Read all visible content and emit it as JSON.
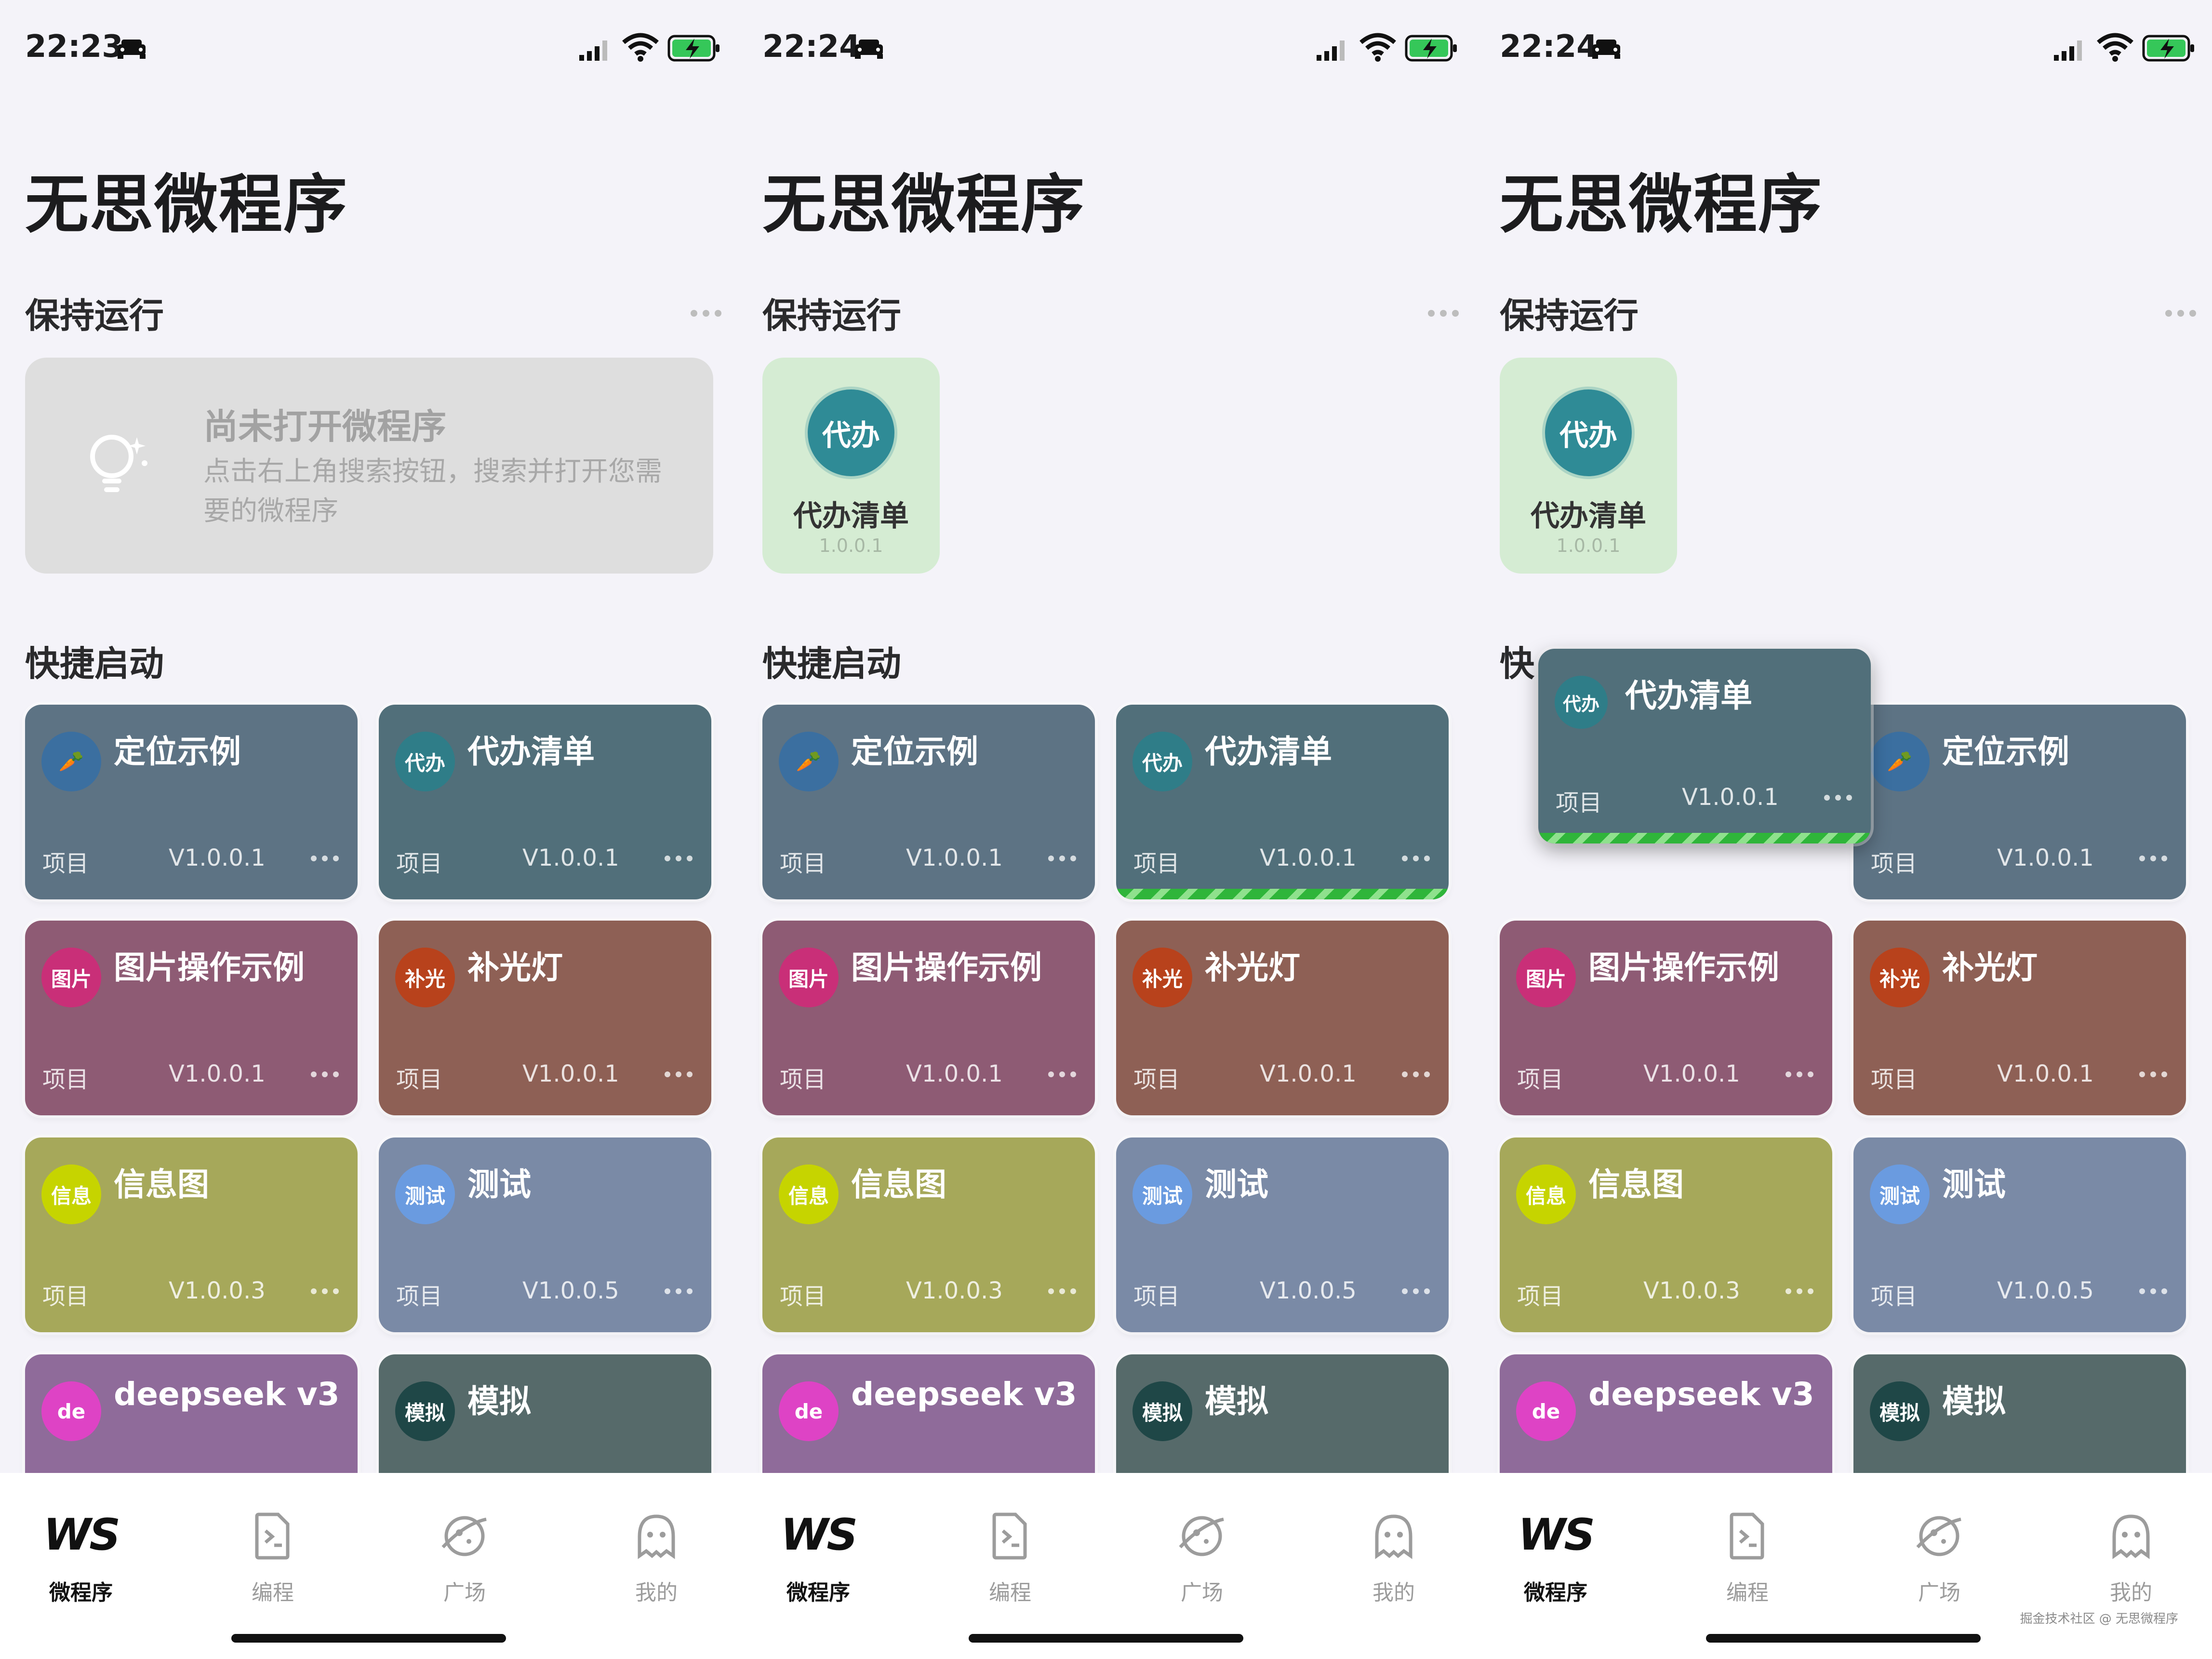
{
  "screens": [
    {
      "status": {
        "time": "22:23"
      },
      "title": "无思微程序",
      "keep_running": {
        "label": "保持运行",
        "empty_title": "尚未打开微程序",
        "empty_desc": "点击右上角搜索按钮，搜索并打开您需要的微程序"
      },
      "quick_launch": {
        "label": "快捷启动"
      }
    },
    {
      "status": {
        "time": "22:24"
      },
      "title": "无思微程序",
      "keep_running": {
        "label": "保持运行",
        "app": {
          "badge": "代办",
          "name": "代办清单",
          "version": "1.0.0.1"
        }
      },
      "quick_launch": {
        "label": "快捷启动"
      }
    },
    {
      "status": {
        "time": "22:24"
      },
      "title": "无思微程序",
      "keep_running": {
        "label": "保持运行",
        "app": {
          "badge": "代办",
          "name": "代办清单",
          "version": "1.0.0.1"
        }
      },
      "quick_launch": {
        "label": "快"
      }
    }
  ],
  "cards": {
    "loc": {
      "badge": "🥕",
      "name": "定位示例",
      "type": "项目",
      "version": "V1.0.0.1"
    },
    "todo": {
      "badge": "代办",
      "name": "代办清单",
      "type": "项目",
      "version": "V1.0.0.1"
    },
    "img": {
      "badge": "图片",
      "name": "图片操作示例",
      "type": "项目",
      "version": "V1.0.0.1"
    },
    "light": {
      "badge": "补光",
      "name": "补光灯",
      "type": "项目",
      "version": "V1.0.0.1"
    },
    "info": {
      "badge": "信息",
      "name": "信息图",
      "type": "项目",
      "version": "V1.0.0.3"
    },
    "test": {
      "badge": "测试",
      "name": "测试",
      "type": "项目",
      "version": "V1.0.0.5"
    },
    "ds": {
      "badge": "de",
      "name": "deepseek v3"
    },
    "sim": {
      "badge": "模拟",
      "name": "模拟"
    }
  },
  "tabs": [
    {
      "label": "微程序",
      "logo": "WS",
      "icon": "ws-logo"
    },
    {
      "label": "编程",
      "icon": "code-file-icon"
    },
    {
      "label": "广场",
      "icon": "planet-icon"
    },
    {
      "label": "我的",
      "icon": "ghost-face-icon"
    }
  ],
  "watermark": "掘金技术社区 @ 无思微程序",
  "colors": {
    "accent_progress": "#2fb53a",
    "keep_running_bg": "#d5ecd3",
    "todo_badge": "#2f8b96"
  }
}
